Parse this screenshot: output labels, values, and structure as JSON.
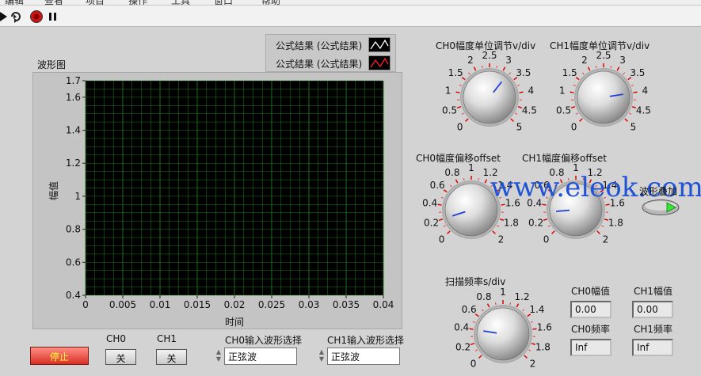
{
  "menu": {
    "items": [
      "编辑",
      "查看",
      "项目",
      "操作",
      "工具",
      "窗口",
      "帮助"
    ]
  },
  "toolbar": {
    "run_icon": "run-arrow-icon",
    "continuous_icon": "run-continuous-icon",
    "abort_icon": "abort-icon",
    "pause_icon": "pause-icon"
  },
  "legend": {
    "items": [
      {
        "label": "公式结果 (公式结果)",
        "color": "#ffffff"
      },
      {
        "label": "公式结果 (公式结果)",
        "color": "#ff2020"
      }
    ]
  },
  "graph": {
    "title": "波形图",
    "xlabel": "时间",
    "ylabel": "幅值",
    "xticks": [
      "0",
      "0.005",
      "0.01",
      "0.015",
      "0.02",
      "0.025",
      "0.03",
      "0.035",
      "0.04"
    ],
    "yticks": [
      "1.7",
      "1.6",
      "1.4",
      "1.2",
      "1",
      "0.8",
      "0.6",
      "0.4"
    ],
    "bg": "#000000",
    "grid_color": "#1f7a1f"
  },
  "knobs": {
    "ch0_amp": {
      "title": "CH0幅度单位调节v/div",
      "ticks": [
        "0",
        "0.5",
        "1",
        "1.5",
        "2",
        "2.5",
        "3",
        "3.5",
        "4",
        "4.5",
        "5"
      ],
      "min": 0,
      "max": 5,
      "value": 3.2
    },
    "ch1_amp": {
      "title": "CH1幅度单位调节v/div",
      "ticks": [
        "0",
        "0.5",
        "1",
        "1.5",
        "2",
        "2.5",
        "3",
        "3.5",
        "4",
        "4.5",
        "5"
      ],
      "min": 0,
      "max": 5,
      "value": 4.0
    },
    "ch0_offset": {
      "title": "CH0幅度偏移offset",
      "ticks": [
        "0",
        "0.2",
        "0.4",
        "0.6",
        "0.8",
        "1",
        "1.2",
        "1.4",
        "1.6",
        "1.8",
        "2"
      ],
      "min": 0,
      "max": 2,
      "value": 0.2
    },
    "ch1_offset": {
      "title": "CH1幅度偏移offset",
      "ticks": [
        "0",
        "0.2",
        "0.4",
        "0.6",
        "0.8",
        "1",
        "1.2",
        "1.4",
        "1.6",
        "1.8",
        "2"
      ],
      "min": 0,
      "max": 2,
      "value": 0.3
    },
    "scan_freq": {
      "title": "扫描频率s/div",
      "ticks": [
        "0",
        "0.2",
        "0.4",
        "0.6",
        "0.8",
        "1",
        "1.2",
        "1.4",
        "1.6",
        "1.8",
        "2"
      ],
      "min": 0,
      "max": 2,
      "value": 0.4
    }
  },
  "indicators": {
    "ch0_amp": {
      "label": "CH0幅值",
      "value": "0.00"
    },
    "ch1_amp": {
      "label": "CH1幅值",
      "value": "0.00"
    },
    "ch0_freq": {
      "label": "CH0频率",
      "value": "Inf"
    },
    "ch1_freq": {
      "label": "CH1频率",
      "value": "Inf"
    }
  },
  "controls": {
    "stop": "停止",
    "ch0_label": "CH0",
    "ch0_btn": "关",
    "ch1_label": "CH1",
    "ch1_btn": "关",
    "ch0_wave_label": "CH0输入波形选择",
    "ch0_wave_value": "正弦波",
    "ch1_wave_label": "CH1输入波形选择",
    "ch1_wave_value": "正弦波",
    "merge_label": "波形叠加"
  },
  "watermark": "www.eleok.com"
}
